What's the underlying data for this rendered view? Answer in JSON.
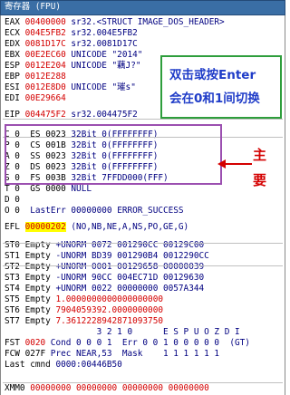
{
  "window_title": "寄存器 (FPU)",
  "registers": [
    {
      "name": "EAX",
      "value": "00400000",
      "comment": "sr32.<STRUCT IMAGE_DOS_HEADER>"
    },
    {
      "name": "ECX",
      "value": "004E5FB2",
      "comment": "sr32.004E5FB2"
    },
    {
      "name": "EDX",
      "value": "0081D17C",
      "comment": "sr32.0081D17C"
    },
    {
      "name": "EBX",
      "value": "00E2EC60",
      "comment": "UNICODE \"2014\""
    },
    {
      "name": "ESP",
      "value": "0012E204",
      "comment": "UNICODE \"藕J?\""
    },
    {
      "name": "EBP",
      "value": "0012E288",
      "comment": ""
    },
    {
      "name": "ESI",
      "value": "0012E8D0",
      "comment": "UNICODE \"璀s\""
    },
    {
      "name": "EDI",
      "value": "00E29664",
      "comment": ""
    }
  ],
  "eip": {
    "name": "EIP",
    "value": "004475F2",
    "comment": "sr32.004475F2"
  },
  "flags": [
    {
      "flag": "C",
      "bit": "0",
      "seg": "ES",
      "sel": "0023",
      "info": "32Bit 0(FFFFFFFF)"
    },
    {
      "flag": "P",
      "bit": "0",
      "seg": "CS",
      "sel": "001B",
      "info": "32Bit 0(FFFFFFFF)"
    },
    {
      "flag": "A",
      "bit": "0",
      "seg": "SS",
      "sel": "0023",
      "info": "32Bit 0(FFFFFFFF)"
    },
    {
      "flag": "Z",
      "bit": "0",
      "seg": "DS",
      "sel": "0023",
      "info": "32Bit 0(FFFFFFFF)"
    },
    {
      "flag": "S",
      "bit": "0",
      "seg": "FS",
      "sel": "003B",
      "info": "32Bit 7FFDD000(FFF)"
    },
    {
      "flag": "T",
      "bit": "0",
      "seg": "GS",
      "sel": "0000",
      "info": "NULL"
    },
    {
      "flag": "D",
      "bit": "0",
      "seg": "",
      "sel": "",
      "info": ""
    },
    {
      "flag": "O",
      "bit": "0",
      "seg": "",
      "sel": "",
      "info": "LastErr 00000000 ERROR_SUCCESS"
    }
  ],
  "efl": {
    "name": "EFL",
    "value": "00000202",
    "comment": "(NO,NB,NE,A,NS,PO,GE,G)"
  },
  "fpu": [
    {
      "name": "ST0",
      "state": "Empty",
      "val": "+UNORM 0072 001290CC 00129C00",
      "red": false
    },
    {
      "name": "ST1",
      "state": "Empty",
      "val": "-UNORM BD39 001290B4 0012290CC",
      "red": false
    },
    {
      "name": "ST2",
      "state": "Empty",
      "val": "+UNORM 0001 00129658 00000039",
      "red": false
    },
    {
      "name": "ST3",
      "state": "Empty",
      "val": "-UNORM 90CC 004EC71D 00129630",
      "red": false
    },
    {
      "name": "ST4",
      "state": "Empty",
      "val": "+UNORM 0022 00000000 0057A344",
      "red": false
    },
    {
      "name": "ST5",
      "state": "Empty",
      "val": "1.0000000000000000000",
      "red": true
    },
    {
      "name": "ST6",
      "state": "Empty",
      "val": "7904059392.0000000000",
      "red": true
    },
    {
      "name": "ST7",
      "state": "Empty",
      "val": "7.3612228942871093750",
      "red": true
    }
  ],
  "fst_header": "3 2 1 0      E S P U O Z D I",
  "fst": {
    "name": "FST",
    "value": "0020",
    "rest": "Cond 0 0 0 1  Err 0 0 1 0 0 0 0 0  (GT)"
  },
  "fcw": {
    "name": "FCW",
    "value": "027F",
    "rest": "Prec NEAR,53  Mask    1 1 1 1 1 1"
  },
  "last_cmnd": {
    "label": "Last cmnd",
    "value": "0000:00446B50"
  },
  "xmm0": {
    "name": "XMM0",
    "value": "00000000 00000000 00000000 00000000"
  },
  "annotation_toggle": "双击或按Enter\n会在0和1间切换",
  "annotation_line1": "双击或按Enter",
  "annotation_line2": "会在0和1间切换",
  "annotation_main_1": "主",
  "annotation_main_2": "要",
  "colors": {
    "title_bg": "#3a6ea5",
    "changed_value": "#d40000",
    "highlight": "#ffff00",
    "note_border": "#2e9e3c",
    "note_text": "#1f3cc8",
    "flag_box": "#9b4fb0"
  }
}
